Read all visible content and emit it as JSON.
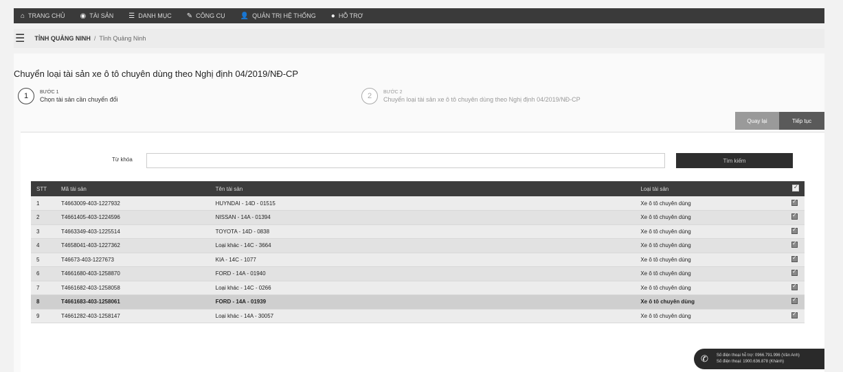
{
  "topnav": {
    "items": [
      {
        "icon": "home-icon",
        "glyph": "⌂",
        "label": "TRANG CHỦ"
      },
      {
        "icon": "globe-icon",
        "glyph": "◉",
        "label": "TÀI SẢN"
      },
      {
        "icon": "list-icon",
        "glyph": "☰",
        "label": "DANH MỤC"
      },
      {
        "icon": "wrench-icon",
        "glyph": "✎",
        "label": "CÔNG CỤ"
      },
      {
        "icon": "user-icon",
        "glyph": "👤",
        "label": "QUẢN TRỊ HỆ THỐNG"
      },
      {
        "icon": "help-icon",
        "glyph": "●",
        "label": "HỖ TRỢ"
      }
    ]
  },
  "breadcrumb": {
    "province": "TỈNH QUẢNG NINH",
    "sub": "Tỉnh Quảng Ninh"
  },
  "page": {
    "title": "Chuyển loại tài sản xe ô tô chuyên dùng theo Nghị định 04/2019/NĐ-CP"
  },
  "steps": [
    {
      "number": "1",
      "top": "BƯỚC 1",
      "desc": "Chọn tài sản cần chuyển đổi"
    },
    {
      "number": "2",
      "top": "BƯỚC 2",
      "desc": "Chuyển loại tài sản xe ô tô chuyên dùng theo Nghị định 04/2019/NĐ-CP"
    }
  ],
  "buttons": {
    "back": "Quay lại",
    "next": "Tiếp tục"
  },
  "search": {
    "label": "Từ khóa",
    "placeholder": "",
    "button": "Tìm kiếm"
  },
  "table": {
    "headers": {
      "stt": "STT",
      "code": "Mã tài sản",
      "name": "Tên tài sản",
      "type": "Loại tài sản"
    },
    "rows": [
      {
        "stt": "1",
        "code": "T4663009-403-1227932",
        "name": "HUYNDAI - 14D - 01515",
        "type": "Xe ô tô chuyên dùng"
      },
      {
        "stt": "2",
        "code": "T4661405-403-1224596",
        "name": "NISSAN - 14A - 01394",
        "type": "Xe ô tô chuyên dùng"
      },
      {
        "stt": "3",
        "code": "T4663349-403-1225514",
        "name": "TOYOTA - 14D - 0838",
        "type": "Xe ô tô chuyên dùng"
      },
      {
        "stt": "4",
        "code": "T4658041-403-1227362",
        "name": "Loại khác - 14C - 3664",
        "type": "Xe ô tô chuyên dùng"
      },
      {
        "stt": "5",
        "code": "T46673-403-1227673",
        "name": "KIA - 14C - 1077",
        "type": "Xe ô tô chuyên dùng"
      },
      {
        "stt": "6",
        "code": "T4661680-403-1258870",
        "name": "FORD - 14A - 01940",
        "type": "Xe ô tô chuyên dùng"
      },
      {
        "stt": "7",
        "code": "T4661682-403-1258058",
        "name": "Loại khác - 14C - 0266",
        "type": "Xe ô tô chuyên dùng"
      },
      {
        "stt": "8",
        "code": "T4661683-403-1258061",
        "name": "FORD - 14A - 01939",
        "type": "Xe ô tô chuyên dùng"
      },
      {
        "stt": "9",
        "code": "T4661282-403-1258147",
        "name": "Loại khác - 14A - 30057",
        "type": "Xe ô tô chuyên dùng"
      }
    ]
  },
  "hotline": {
    "line1": "Số điện thoại hỗ trợ: 0966.791.996 (Vân Anh)",
    "line2": "Số điện thoại: 1900.636.878 (Khánh)"
  }
}
